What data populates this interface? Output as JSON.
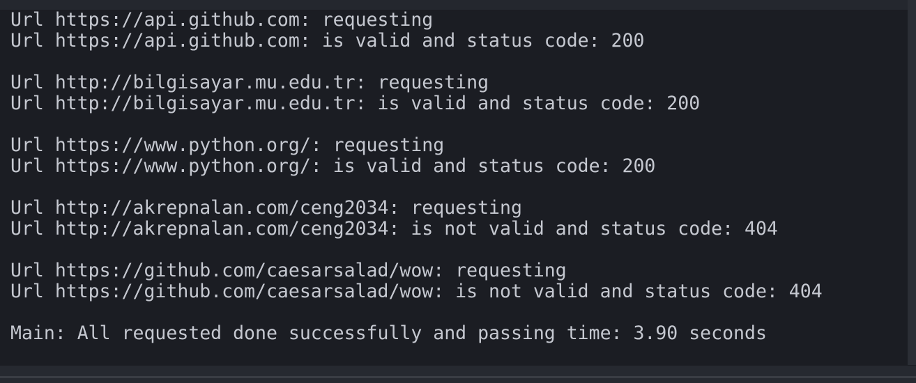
{
  "terminal": {
    "lines": [
      "Url https://api.github.com: requesting",
      "Url https://api.github.com: is valid and status code: 200",
      "",
      "Url http://bilgisayar.mu.edu.tr: requesting",
      "Url http://bilgisayar.mu.edu.tr: is valid and status code: 200",
      "",
      "Url https://www.python.org/: requesting",
      "Url https://www.python.org/: is valid and status code: 200",
      "",
      "Url http://akrepnalan.com/ceng2034: requesting",
      "Url http://akrepnalan.com/ceng2034: is not valid and status code: 404",
      "",
      "Url https://github.com/caesarsalad/wow: requesting",
      "Url https://github.com/caesarsalad/wow: is not valid and status code: 404",
      "",
      "Main: All requested done successfully and passing time: 3.90 seconds"
    ]
  },
  "colors": {
    "background": "#1b1d23",
    "text": "#c5c8d0"
  }
}
